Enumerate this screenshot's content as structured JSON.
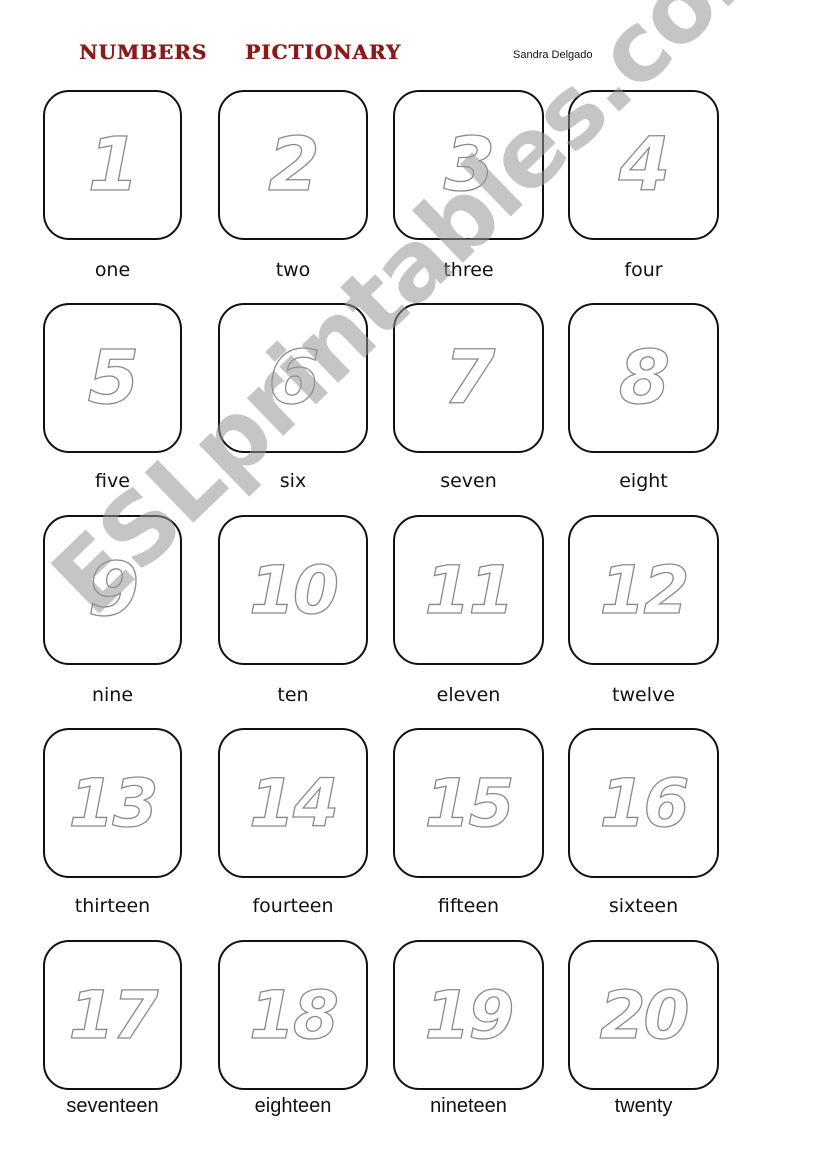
{
  "header": {
    "title_words": [
      "NUMBERS",
      "PICTIONARY"
    ],
    "author": "Sandra Delgado",
    "title_color": "#8b1a1a"
  },
  "watermark": "ESLprintables.com",
  "cards": [
    {
      "numeral": "1",
      "word": "one"
    },
    {
      "numeral": "2",
      "word": "two"
    },
    {
      "numeral": "3",
      "word": "three"
    },
    {
      "numeral": "4",
      "word": "four"
    },
    {
      "numeral": "5",
      "word": "five"
    },
    {
      "numeral": "6",
      "word": "six"
    },
    {
      "numeral": "7",
      "word": "seven"
    },
    {
      "numeral": "8",
      "word": "eight"
    },
    {
      "numeral": "9",
      "word": "nine"
    },
    {
      "numeral": "10",
      "word": "ten"
    },
    {
      "numeral": "11",
      "word": "eleven"
    },
    {
      "numeral": "12",
      "word": "twelve"
    },
    {
      "numeral": "13",
      "word": "thirteen"
    },
    {
      "numeral": "14",
      "word": "fourteen"
    },
    {
      "numeral": "15",
      "word": "fifteen"
    },
    {
      "numeral": "16",
      "word": "sixteen"
    },
    {
      "numeral": "17",
      "word": "seventeen"
    },
    {
      "numeral": "18",
      "word": "eighteen"
    },
    {
      "numeral": "19",
      "word": "nineteen"
    },
    {
      "numeral": "20",
      "word": "twenty"
    }
  ]
}
